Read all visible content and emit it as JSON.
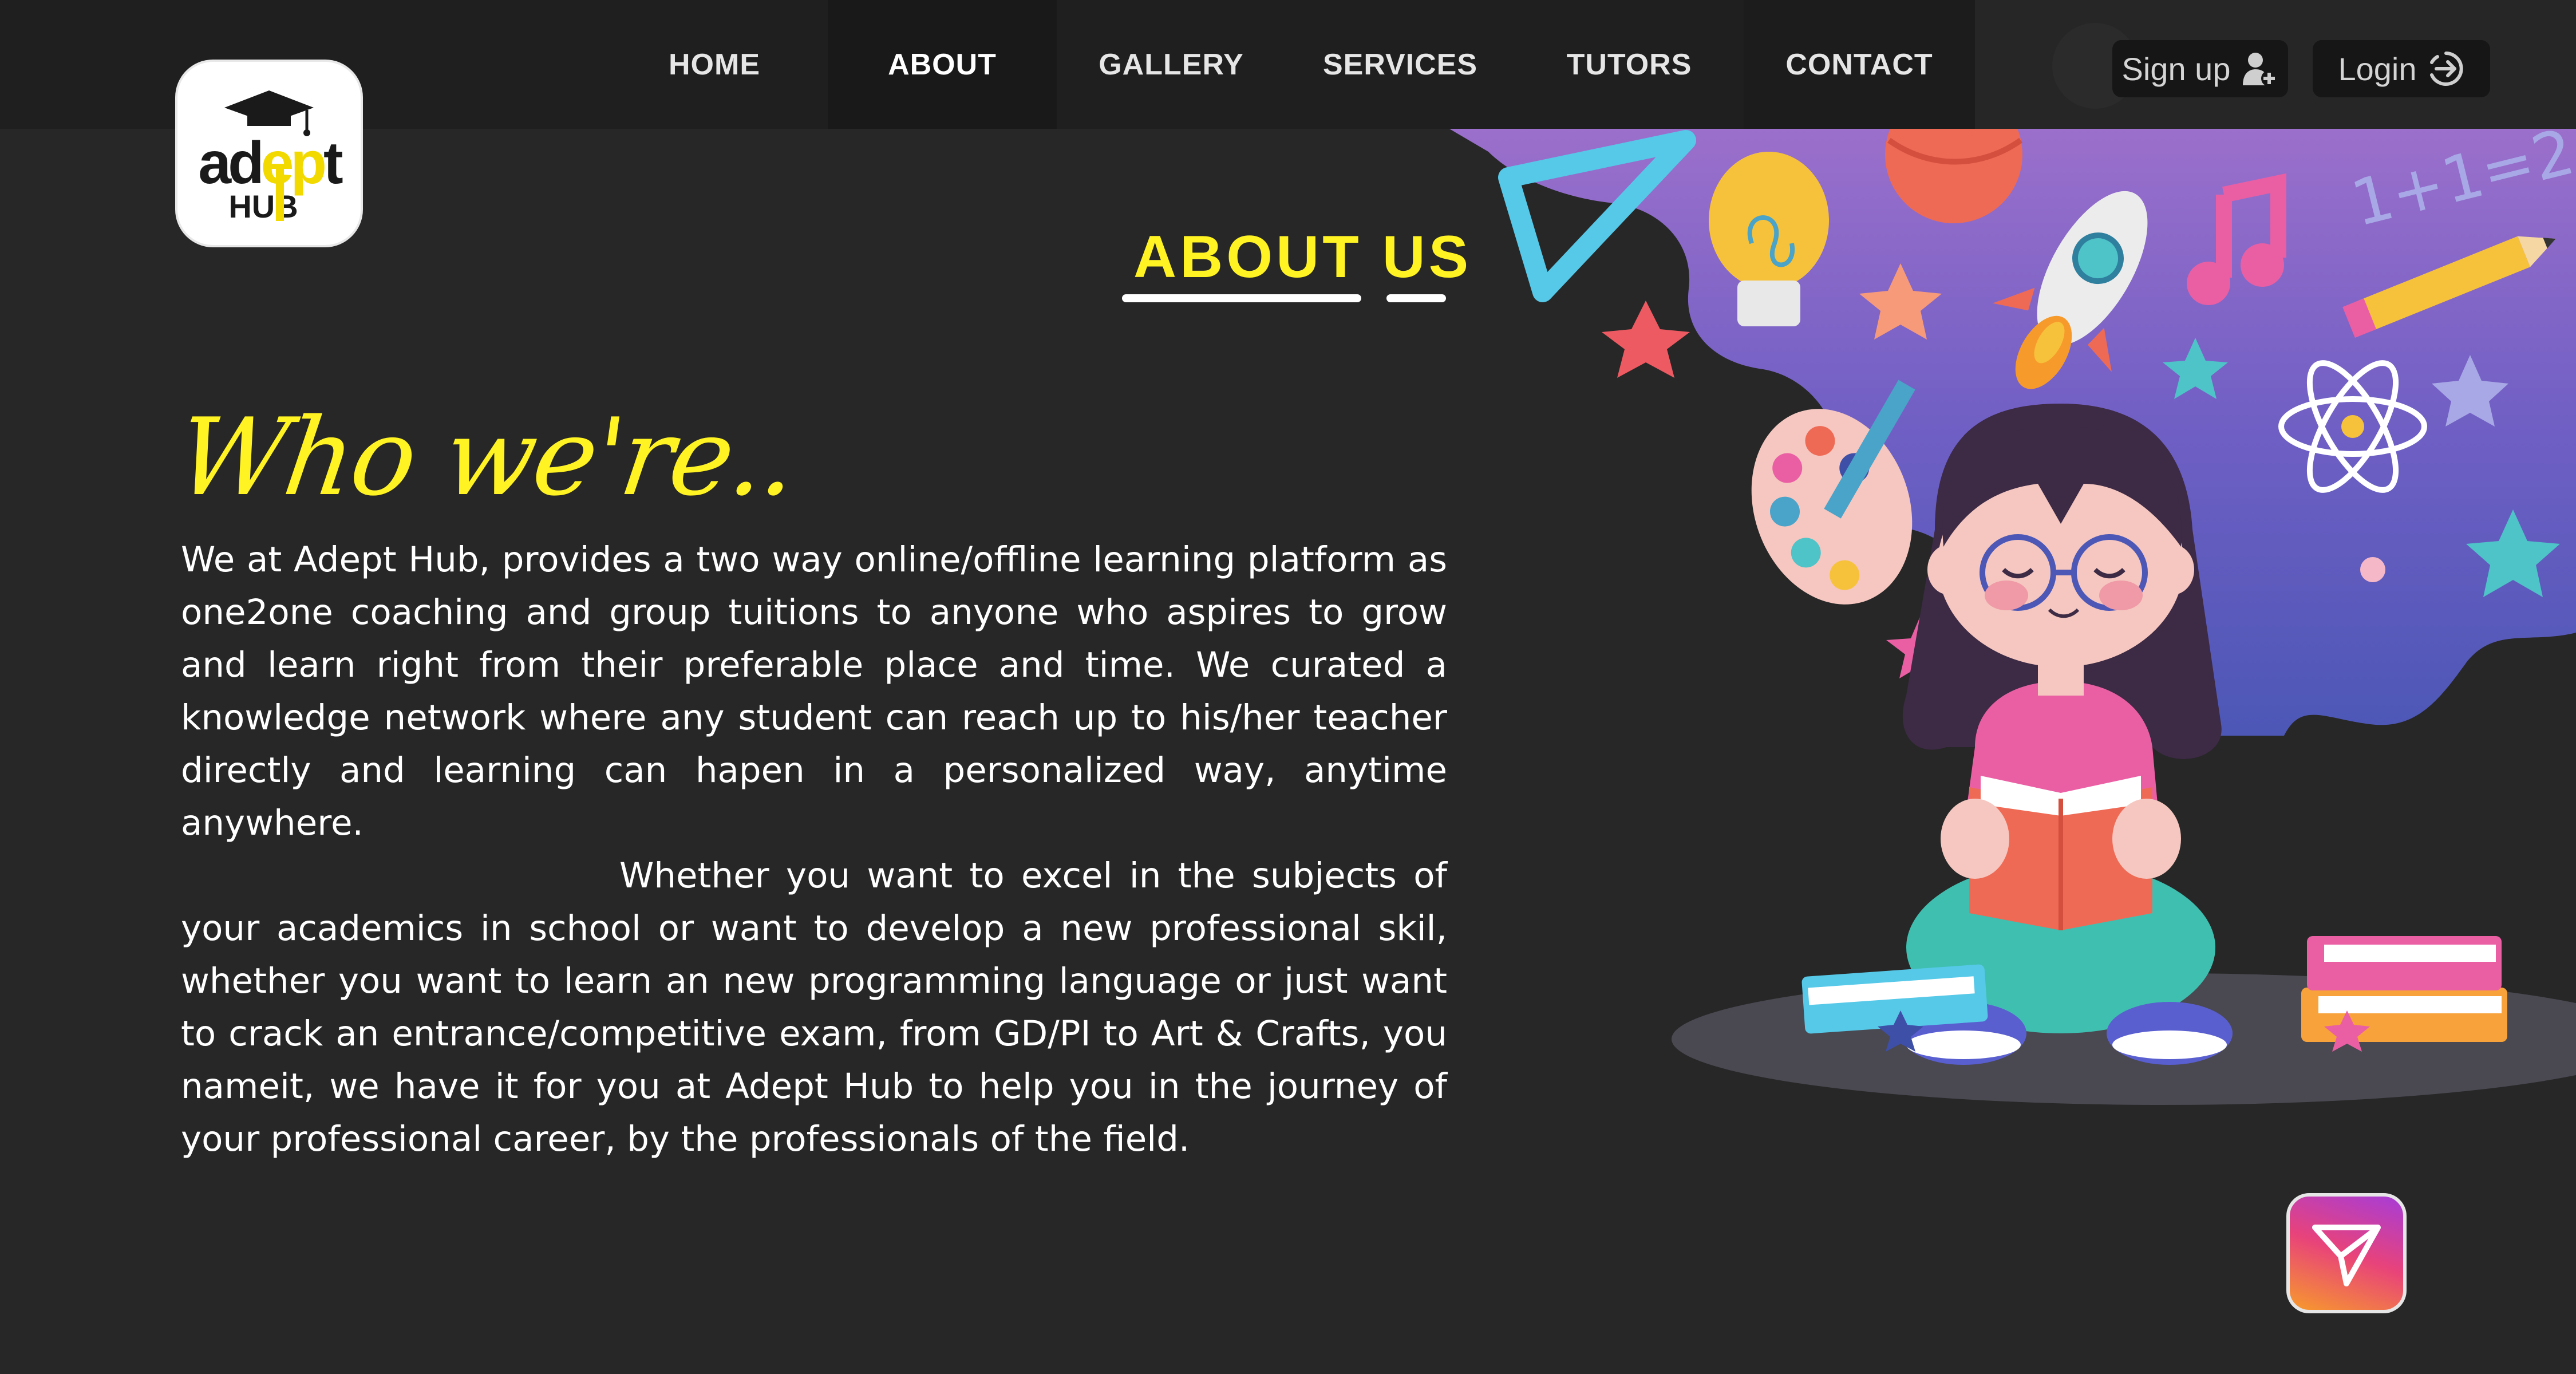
{
  "brand": {
    "logo_text_top": "adept",
    "logo_text_bottom": "HUB",
    "colors": {
      "accent": "#fff323",
      "background": "#272727",
      "navbar": "#1f1f1f"
    }
  },
  "nav": {
    "items": [
      {
        "label": "HOME"
      },
      {
        "label": "ABOUT",
        "active": true
      },
      {
        "label": "GALLERY"
      },
      {
        "label": "SERVICES"
      },
      {
        "label": "TUTORS"
      },
      {
        "label": "CONTACT"
      }
    ],
    "signup_label": "Sign up",
    "login_label": "Login",
    "signup_icon": "add-user-icon",
    "login_icon": "login-arrow-icon"
  },
  "about": {
    "heading": "ABOUT US",
    "who_heading": "Who we're..",
    "paragraph1": "We at Adept Hub, provides a two way online/offline learning platform as one2one coaching and group tuitions to anyone who aspires to grow and learn right from their preferable place and time. We curated a knowledge network where any student can reach up to his/her teacher directly and learning can hapen in a personalized way, anytime anywhere.",
    "paragraph2": "Whether you want to excel in the subjects of your academics in school or want to develop a new professional skil, whether you want to learn an new programming language or just want to crack an entrance/competitive exam, from GD/PI to Art & Crafts, you nameit, we have it for you at Adept Hub to help you in the journey of your professional career, by the professionals of the field."
  },
  "illustration": {
    "math_text": "1+1=2",
    "subject": "girl-reading-book-illustration"
  },
  "fab": {
    "icon": "send-icon"
  }
}
